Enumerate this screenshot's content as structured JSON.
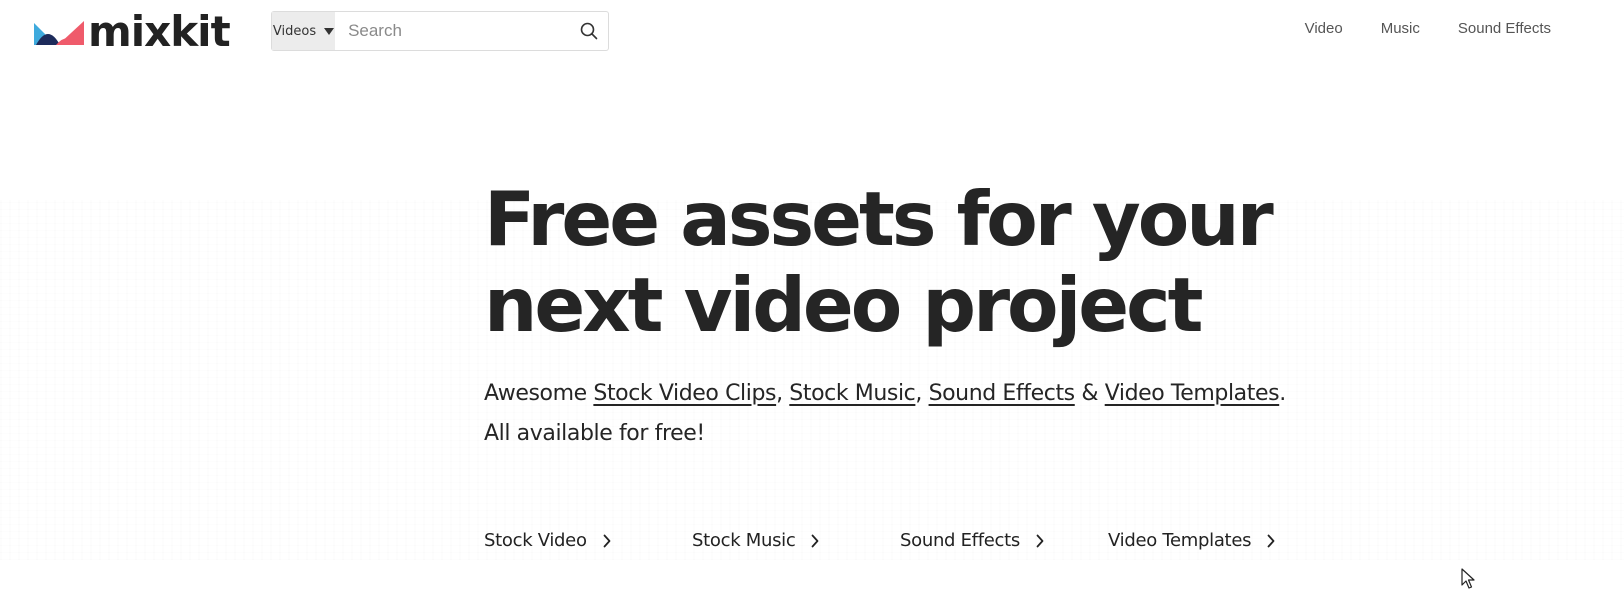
{
  "brand": {
    "name": "mixkit",
    "colors": {
      "blue": "#3eaadd",
      "pink": "#ef5b6b",
      "navy": "#1d2b5b"
    }
  },
  "search": {
    "category_label": "Videos",
    "placeholder": "Search",
    "value": ""
  },
  "topnav": [
    {
      "label": "Video"
    },
    {
      "label": "Music"
    },
    {
      "label": "Sound Effects"
    }
  ],
  "hero": {
    "title_line1": "Free assets for your",
    "title_line2": "next video project",
    "sub_prefix": "Awesome ",
    "link1": "Stock Video Clips",
    "sep1": ", ",
    "link2": "Stock Music",
    "sep2": ", ",
    "link3": "Sound Effects",
    "sep3": " & ",
    "link4": "Video Templates",
    "sub_end": ".",
    "sub_line2": "All available for free!"
  },
  "categories": [
    {
      "label": "Stock Video"
    },
    {
      "label": "Stock Music"
    },
    {
      "label": "Sound Effects"
    },
    {
      "label": "Video Templates"
    }
  ]
}
